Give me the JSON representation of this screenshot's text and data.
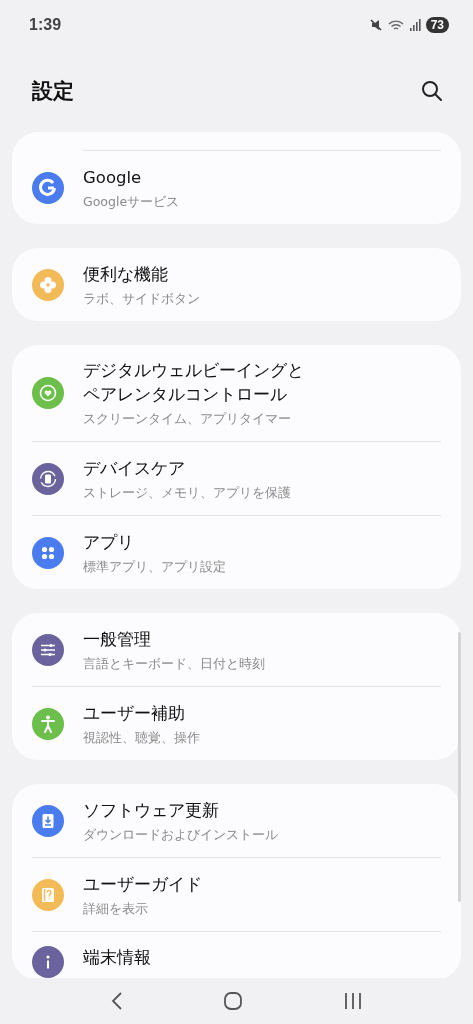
{
  "status_bar": {
    "time": "1:39",
    "battery": "73"
  },
  "header": {
    "title": "設定"
  },
  "groups": [
    {
      "items": [
        {
          "title": "Google",
          "subtitle": "Googleサービス",
          "color": "#4a7cf0"
        }
      ]
    },
    {
      "items": [
        {
          "title": "便利な機能",
          "subtitle": "ラボ、サイドボタン",
          "color": "#f2bb58"
        }
      ]
    },
    {
      "items": [
        {
          "title": "デジタルウェルビーイングとペアレンタルコントロール",
          "subtitle": "スクリーンタイム、アプリタイマー",
          "color": "#6cbf4a"
        },
        {
          "title": "デバイスケア",
          "subtitle": "ストレージ、メモリ、アプリを保護",
          "color": "#6a639e"
        },
        {
          "title": "アプリ",
          "subtitle": "標準アプリ、アプリ設定",
          "color": "#4a7cf0"
        }
      ]
    },
    {
      "items": [
        {
          "title": "一般管理",
          "subtitle": "言語とキーボード、日付と時刻",
          "color": "#6a639e"
        },
        {
          "title": "ユーザー補助",
          "subtitle": "視認性、聴覚、操作",
          "color": "#6cbf4a"
        }
      ]
    },
    {
      "items": [
        {
          "title": "ソフトウェア更新",
          "subtitle": "ダウンロードおよびインストール",
          "color": "#4a7cf0"
        },
        {
          "title": "ユーザーガイド",
          "subtitle": "詳細を表示",
          "color": "#f2bb58"
        },
        {
          "title": "端末情報",
          "color": "#6a639e"
        }
      ]
    }
  ]
}
